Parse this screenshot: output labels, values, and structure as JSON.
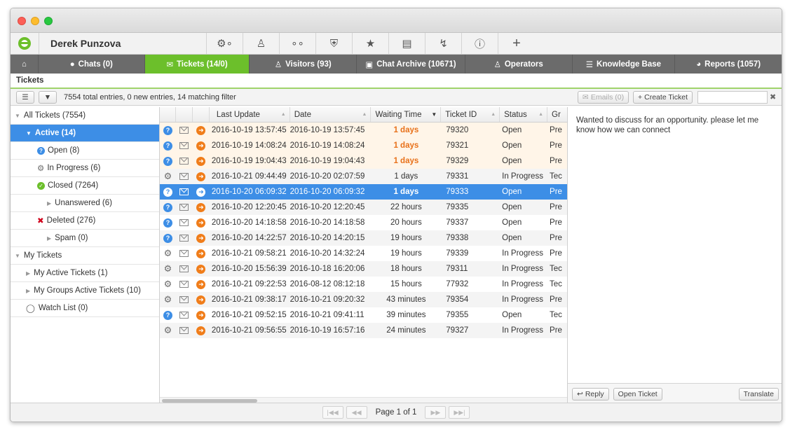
{
  "toolbar": {
    "user_name": "Derek Punzova",
    "buttons": [
      "gears-icon",
      "user-icon",
      "links-icon",
      "shield-icon",
      "star-icon",
      "translate-icon",
      "bolt-icon",
      "info-icon",
      "plus-icon"
    ]
  },
  "nav": {
    "home_icon": "home-icon",
    "tabs": [
      {
        "label": "Chats (0)"
      },
      {
        "label": "Tickets (14/0)"
      },
      {
        "label": "Visitors (93)"
      },
      {
        "label": "Chat Archive (10671)"
      },
      {
        "label": "Operators"
      },
      {
        "label": "Knowledge Base"
      },
      {
        "label": "Reports (1057)"
      }
    ]
  },
  "section_title": "Tickets",
  "filterbar": {
    "summary": "7554 total entries, 0 new entries, 14 matching filter",
    "emails_label": "Emails (0)",
    "create_label": "Create Ticket",
    "search_value": ""
  },
  "sidebar": {
    "items": [
      {
        "label": "All Tickets (7554)"
      },
      {
        "label": "Active (14)"
      },
      {
        "label": "Open (8)"
      },
      {
        "label": "In Progress (6)"
      },
      {
        "label": "Closed (7264)"
      },
      {
        "label": "Unanswered (6)"
      },
      {
        "label": "Deleted (276)"
      },
      {
        "label": "Spam (0)"
      },
      {
        "label": "My Tickets"
      },
      {
        "label": "My Active Tickets (1)"
      },
      {
        "label": "My Groups Active Tickets (10)"
      },
      {
        "label": "Watch List (0)"
      }
    ]
  },
  "table": {
    "headers": [
      "Last Update",
      "Date",
      "Waiting Time",
      "Ticket ID",
      "Status",
      "Gr"
    ],
    "rows": [
      {
        "type": "q",
        "last_update": "2016-10-19 13:57:45",
        "date": "2016-10-19 13:57:45",
        "waiting": "1 days",
        "ticket_id": "79320",
        "status": "Open",
        "group": "Pre"
      },
      {
        "type": "q",
        "last_update": "2016-10-19 14:08:24",
        "date": "2016-10-19 14:08:24",
        "waiting": "1 days",
        "ticket_id": "79321",
        "status": "Open",
        "group": "Pre"
      },
      {
        "type": "q",
        "last_update": "2016-10-19 19:04:43",
        "date": "2016-10-19 19:04:43",
        "waiting": "1 days",
        "ticket_id": "79329",
        "status": "Open",
        "group": "Pre"
      },
      {
        "type": "g",
        "last_update": "2016-10-21 09:44:49",
        "date": "2016-10-20 02:07:59",
        "waiting": "1 days",
        "ticket_id": "79331",
        "status": "In Progress",
        "group": "Tec"
      },
      {
        "type": "q",
        "last_update": "2016-10-20 06:09:32",
        "date": "2016-10-20 06:09:32",
        "waiting": "1 days",
        "ticket_id": "79333",
        "status": "Open",
        "group": "Pre"
      },
      {
        "type": "q",
        "last_update": "2016-10-20 12:20:45",
        "date": "2016-10-20 12:20:45",
        "waiting": "22 hours",
        "ticket_id": "79335",
        "status": "Open",
        "group": "Pre"
      },
      {
        "type": "q",
        "last_update": "2016-10-20 14:18:58",
        "date": "2016-10-20 14:18:58",
        "waiting": "20 hours",
        "ticket_id": "79337",
        "status": "Open",
        "group": "Pre"
      },
      {
        "type": "q",
        "last_update": "2016-10-20 14:22:57",
        "date": "2016-10-20 14:20:15",
        "waiting": "19 hours",
        "ticket_id": "79338",
        "status": "Open",
        "group": "Pre"
      },
      {
        "type": "g",
        "last_update": "2016-10-21 09:58:21",
        "date": "2016-10-20 14:32:24",
        "waiting": "19 hours",
        "ticket_id": "79339",
        "status": "In Progress",
        "group": "Pre"
      },
      {
        "type": "g",
        "last_update": "2016-10-20 15:56:39",
        "date": "2016-10-18 16:20:06",
        "waiting": "18 hours",
        "ticket_id": "79311",
        "status": "In Progress",
        "group": "Tec"
      },
      {
        "type": "g",
        "last_update": "2016-10-21 09:22:53",
        "date": "2016-08-12 08:12:18",
        "waiting": "15 hours",
        "ticket_id": "77932",
        "status": "In Progress",
        "group": "Tec"
      },
      {
        "type": "g",
        "last_update": "2016-10-21 09:38:17",
        "date": "2016-10-21 09:20:32",
        "waiting": "43 minutes",
        "ticket_id": "79354",
        "status": "In Progress",
        "group": "Pre"
      },
      {
        "type": "q",
        "last_update": "2016-10-21 09:52:15",
        "date": "2016-10-21 09:41:11",
        "waiting": "39 minutes",
        "ticket_id": "79355",
        "status": "Open",
        "group": "Tec"
      },
      {
        "type": "g",
        "last_update": "2016-10-21 09:56:55",
        "date": "2016-10-19 16:57:16",
        "waiting": "24 minutes",
        "ticket_id": "79327",
        "status": "In Progress",
        "group": "Pre"
      }
    ]
  },
  "preview": {
    "text": "Wanted to discuss for an opportunity. please let me know how we can connect",
    "reply_label": "Reply",
    "open_ticket_label": "Open Ticket",
    "translate_label": "Translate"
  },
  "pagination": {
    "label": "Page 1 of 1"
  },
  "colors": {
    "accent_green": "#6cbf2b",
    "selection_blue": "#3d8ee6",
    "late_orange": "#e8711a"
  }
}
